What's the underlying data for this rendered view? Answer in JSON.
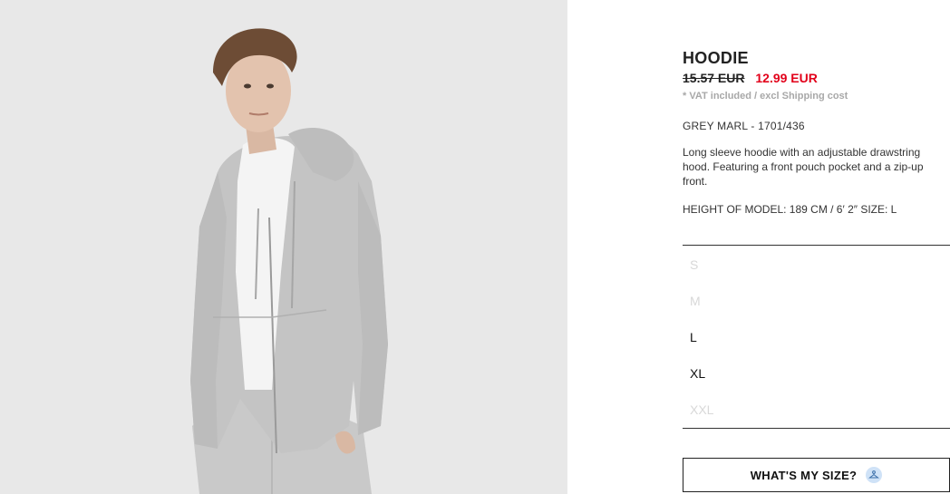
{
  "product": {
    "name": "HOODIE",
    "price_old": "15.57 EUR",
    "price_new": "12.99 EUR",
    "vat_note": "* VAT included / excl Shipping cost",
    "color_ref": "GREY MARL - 1701/436",
    "description": "Long sleeve hoodie with an adjustable drawstring hood. Featuring a front pouch pocket and a zip-up front.",
    "model_info": "HEIGHT OF MODEL: 189 CM / 6′ 2″ SIZE: L"
  },
  "sizes": [
    {
      "label": "S",
      "available": false
    },
    {
      "label": "M",
      "available": false
    },
    {
      "label": "L",
      "available": true
    },
    {
      "label": "XL",
      "available": true
    },
    {
      "label": "XXL",
      "available": false
    }
  ],
  "size_button": {
    "label": "WHAT'S MY SIZE?",
    "icon": "hanger-icon"
  },
  "colors": {
    "sale_red": "#e2001a",
    "muted_grey": "#a8a8a8",
    "unavailable": "#d8d8d8",
    "icon_bg": "#cfe2f7"
  }
}
